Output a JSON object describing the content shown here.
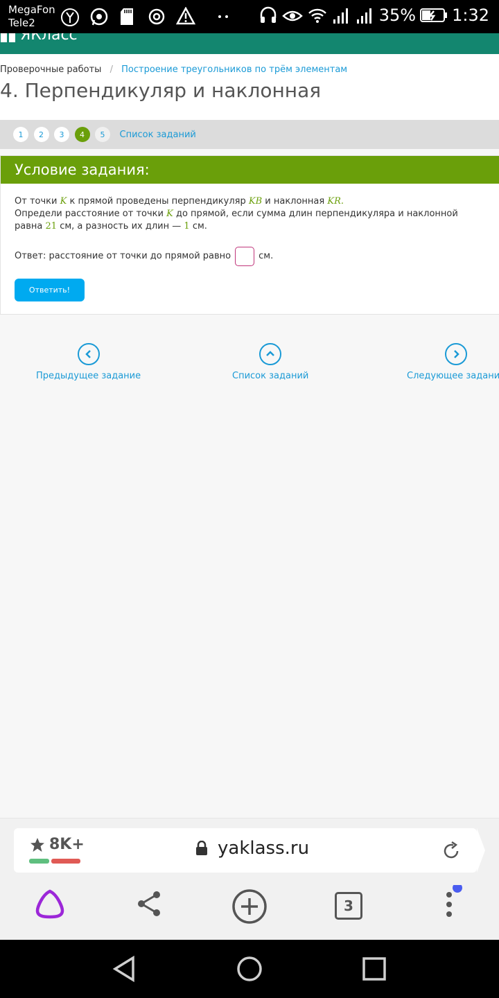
{
  "status_bar": {
    "carrier1": "MegaFon",
    "carrier2": "Tele2",
    "battery": "35%",
    "time": "1:32"
  },
  "site": {
    "logo_text": "ЯКласс",
    "brand_color": "#13866f"
  },
  "breadcrumb": {
    "item1": "Проверочные работы",
    "sep": "/",
    "item2": "Построение треугольников по трём элементам"
  },
  "title": "4. Перпендикуляр и наклонная",
  "pager": {
    "pages": [
      "1",
      "2",
      "3",
      "4",
      "5"
    ],
    "active": "4",
    "list_link": "Список заданий"
  },
  "task": {
    "header": "Условие задания:",
    "line1_a": "От точки",
    "var_K": "K",
    "line1_b": "к прямой проведены перпендикуляр",
    "var_KB": "KB",
    "line1_c": "и наклонная",
    "var_KR": "KR",
    "dot": ".",
    "line2_a": "Определи расстояние от точки",
    "line2_b": "до прямой, если сумма длин перпендикуляра и наклонной равна",
    "num_sum": "21",
    "line2_c": "см, а разность их длин —",
    "num_diff": "1",
    "line2_d": "см.",
    "answer_label": "Ответ: расстояние от точки до прямой равно",
    "answer_value": "",
    "answer_unit": "см.",
    "submit": "Ответить!",
    "accent_color": "#6a9f0a"
  },
  "nav": {
    "prev": "Предыдущее задание",
    "list": "Список заданий",
    "next": "Следующее задание"
  },
  "browser": {
    "rating": "8K+",
    "url": "yaklass.ru",
    "tabs_count": "3"
  }
}
